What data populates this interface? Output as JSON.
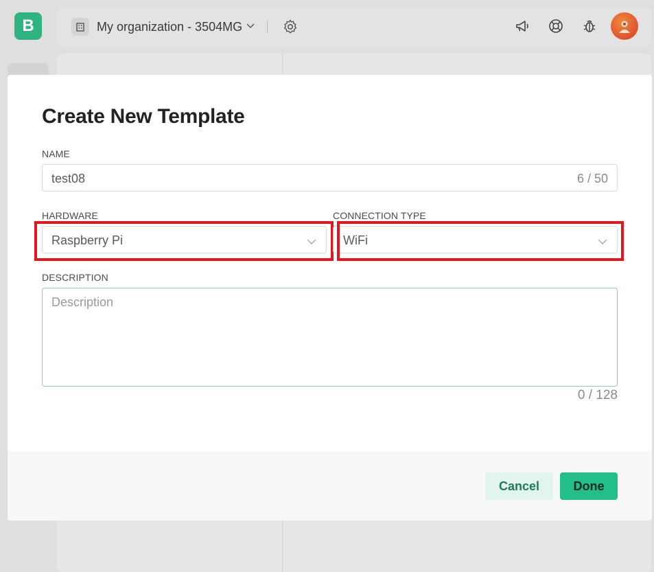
{
  "app": {
    "logo_letter": "B",
    "organization": "My organization - 3504MG",
    "icons": [
      "building-icon",
      "chevron-down-icon",
      "gear-icon",
      "megaphone-icon",
      "lifebuoy-icon",
      "bug-icon",
      "avatar"
    ]
  },
  "modal": {
    "title": "Create New Template",
    "name": {
      "label": "NAME",
      "value": "test08",
      "counter": "6 / 50"
    },
    "hardware": {
      "label": "HARDWARE",
      "value": "Raspberry Pi"
    },
    "connection": {
      "label": "CONNECTION TYPE",
      "value": "WiFi"
    },
    "description": {
      "label": "DESCRIPTION",
      "placeholder": "Description",
      "counter": "0 / 128"
    },
    "buttons": {
      "cancel": "Cancel",
      "done": "Done"
    }
  },
  "colors": {
    "accent": "#22bf8a",
    "highlight": "#e3161d"
  }
}
